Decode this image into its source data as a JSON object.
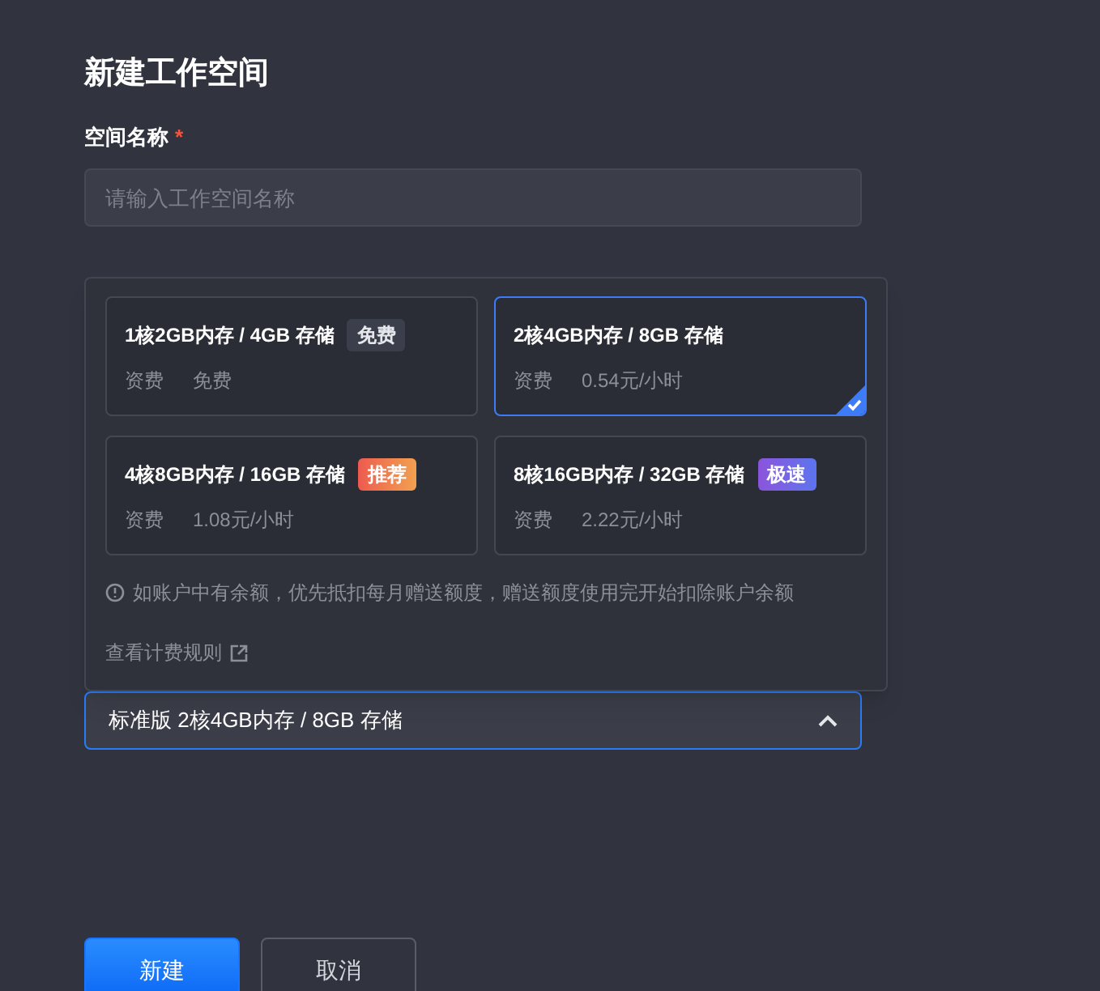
{
  "title": "新建工作空间",
  "name_field": {
    "label": "空间名称",
    "required_mark": "*",
    "placeholder": "请输入工作空间名称"
  },
  "spec_popover": {
    "options": [
      {
        "spec": "1核2GB内存 / 4GB 存储",
        "tag": {
          "text": "免费",
          "kind": "free"
        },
        "fee_label": "资费",
        "fee": "免费",
        "selected": false
      },
      {
        "spec": "2核4GB内存 / 8GB 存储",
        "fee_label": "资费",
        "fee": "0.54元/小时",
        "selected": true
      },
      {
        "spec": "4核8GB内存 / 16GB 存储",
        "tag": {
          "text": "推荐",
          "kind": "recommended"
        },
        "fee_label": "资费",
        "fee": "1.08元/小时",
        "selected": false
      },
      {
        "spec": "8核16GB内存 / 32GB 存储",
        "tag": {
          "text": "极速",
          "kind": "fast"
        },
        "fee_label": "资费",
        "fee": "2.22元/小时",
        "selected": false
      }
    ],
    "notice": "如账户中有余额，优先抵扣每月赠送额度，赠送额度使用完开始扣除账户余额",
    "rules_link": "查看计费规则"
  },
  "spec_select": {
    "value": "标准版 2核4GB内存 / 8GB 存储",
    "expanded": true
  },
  "buttons": [
    {
      "label": "新建",
      "kind": "primary"
    },
    {
      "label": "取消",
      "kind": "secondary"
    }
  ]
}
